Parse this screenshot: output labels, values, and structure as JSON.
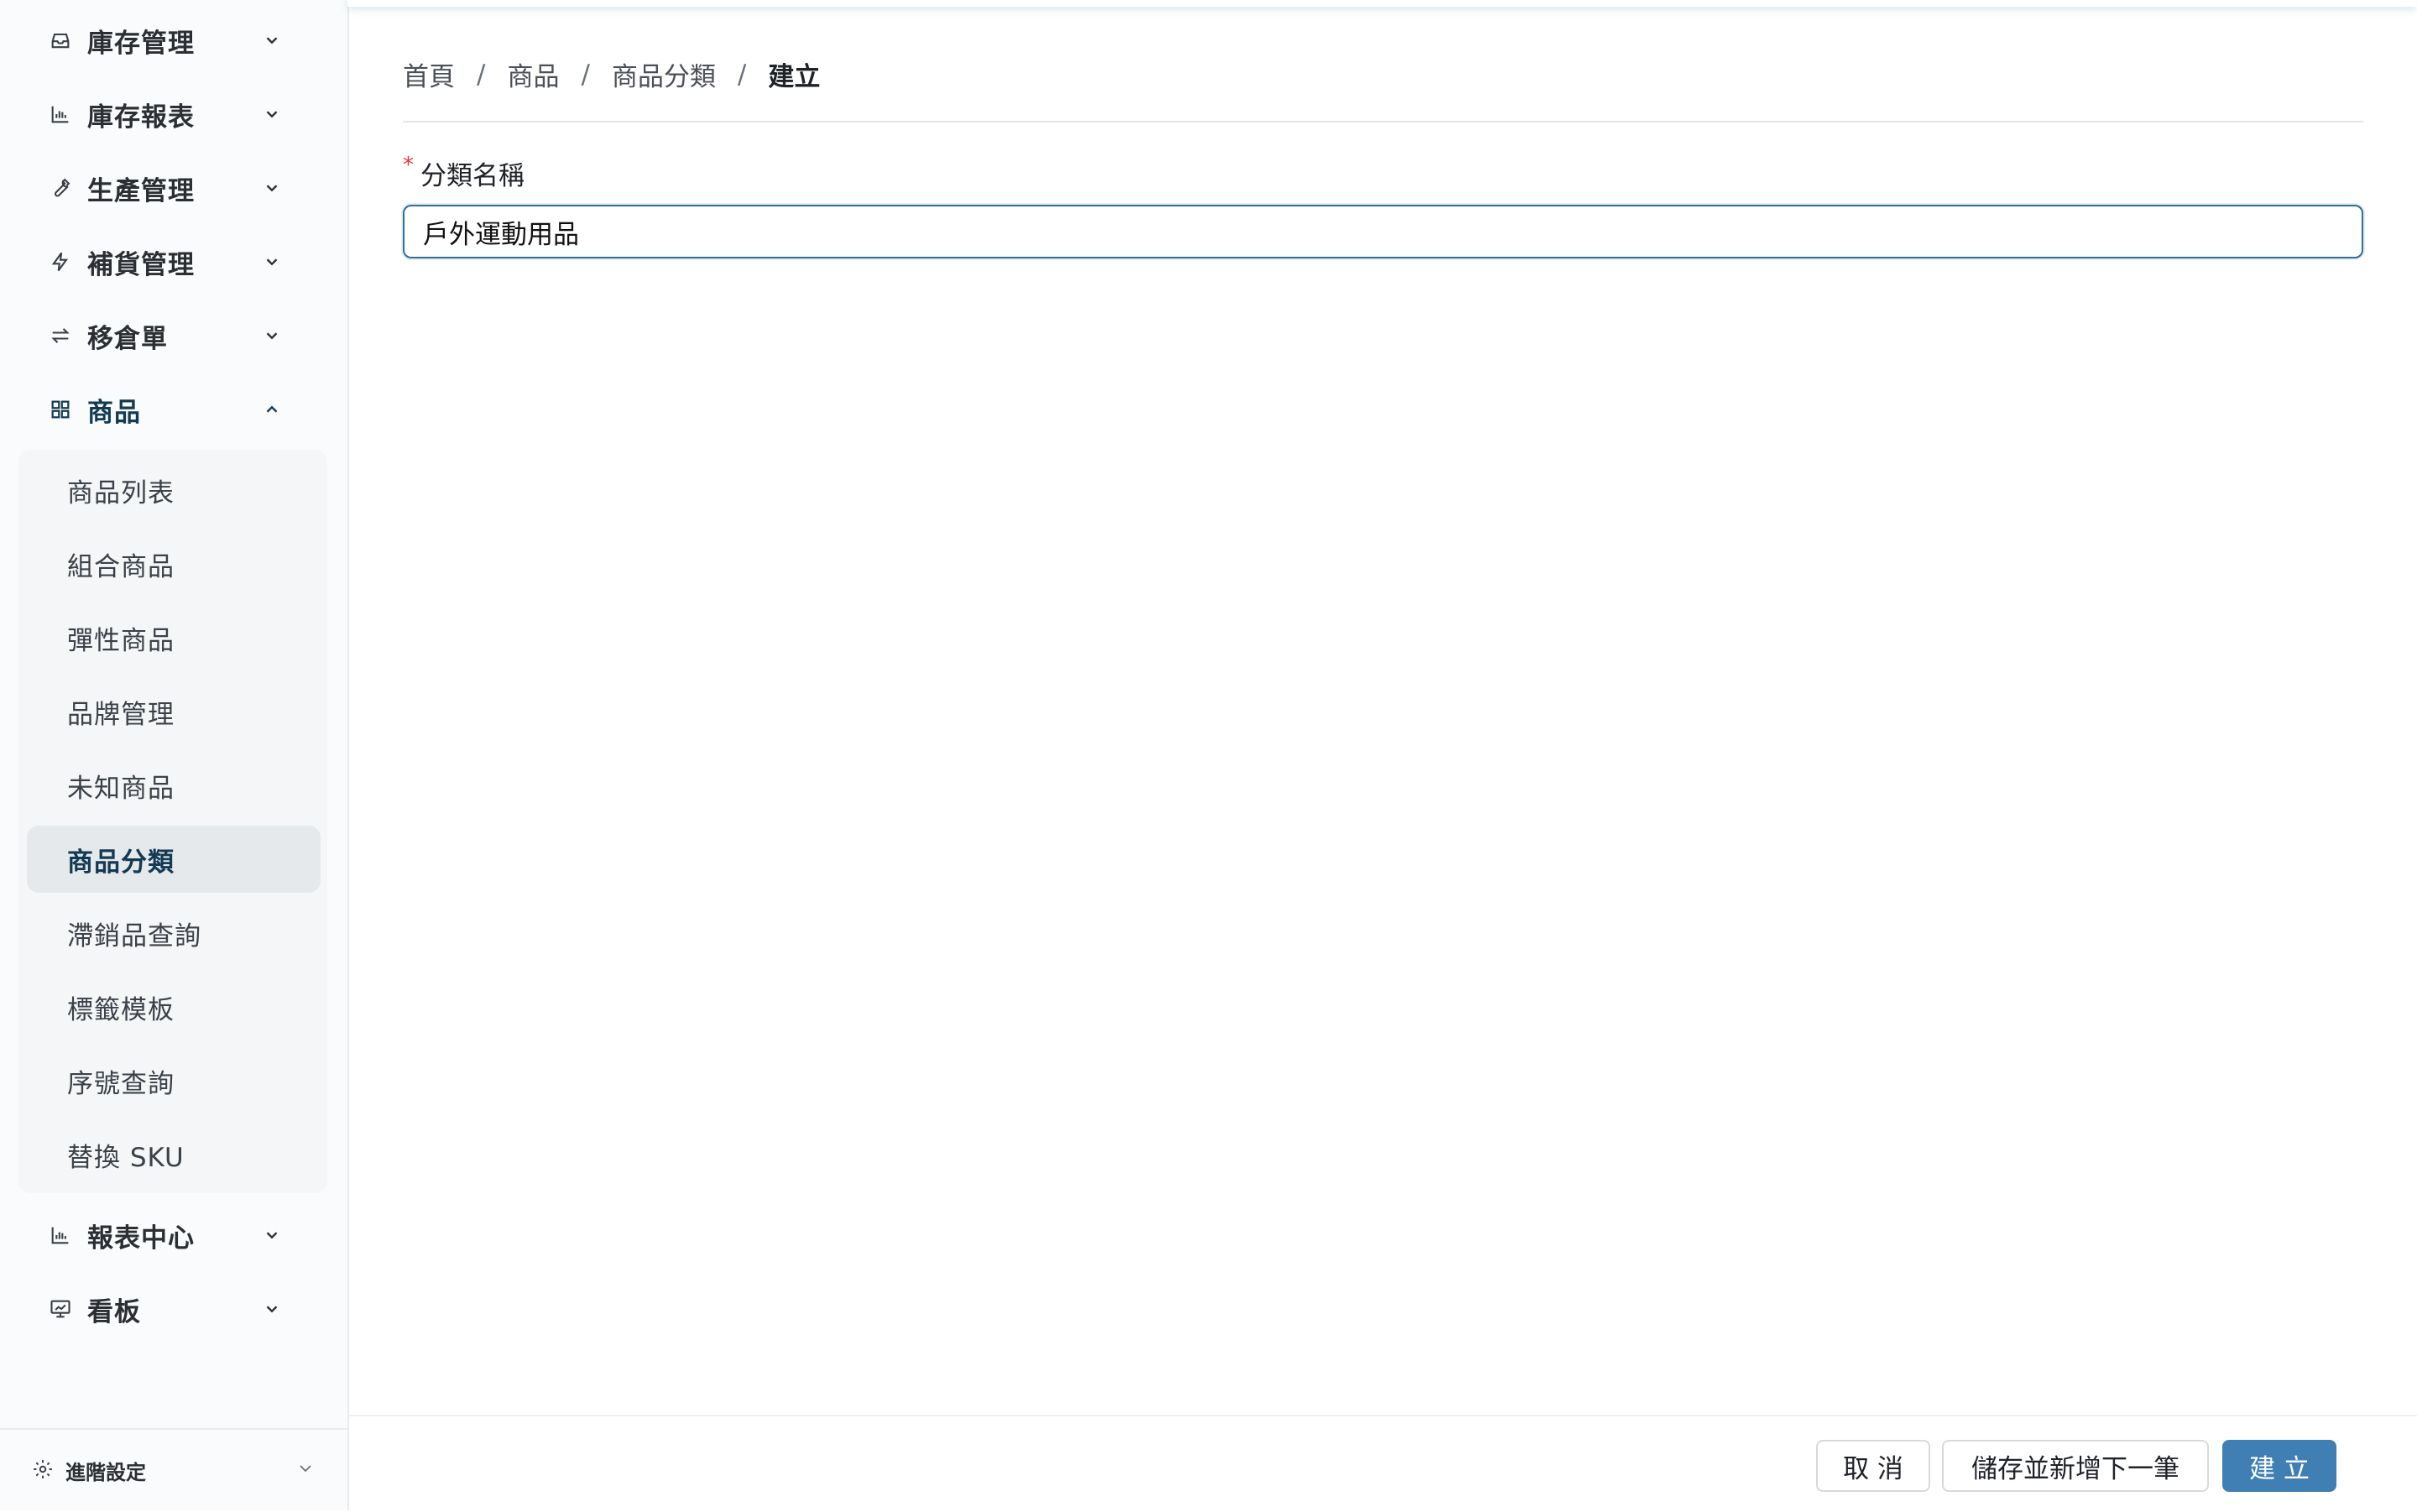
{
  "sidebar": {
    "items": [
      {
        "label": "庫存管理",
        "icon": "inbox-icon"
      },
      {
        "label": "庫存報表",
        "icon": "bar-chart-icon"
      },
      {
        "label": "生產管理",
        "icon": "wrench-icon"
      },
      {
        "label": "補貨管理",
        "icon": "lightning-icon"
      },
      {
        "label": "移倉單",
        "icon": "transfer-icon"
      },
      {
        "label": "商品",
        "icon": "grid-icon",
        "expanded": true
      },
      {
        "label": "報表中心",
        "icon": "bar-chart-icon"
      },
      {
        "label": "看板",
        "icon": "dashboard-icon"
      }
    ],
    "product_subitems": [
      {
        "label": "商品列表"
      },
      {
        "label": "組合商品"
      },
      {
        "label": "彈性商品"
      },
      {
        "label": "品牌管理"
      },
      {
        "label": "未知商品"
      },
      {
        "label": "商品分類",
        "active": true
      },
      {
        "label": "滯銷品查詢"
      },
      {
        "label": "標籤模板"
      },
      {
        "label": "序號查詢"
      },
      {
        "label": "替換 SKU"
      }
    ],
    "footer": {
      "label": "進階設定",
      "icon": "gear-icon"
    }
  },
  "breadcrumb": [
    {
      "label": "首頁"
    },
    {
      "label": "商品"
    },
    {
      "label": "商品分類"
    },
    {
      "label": "建立"
    }
  ],
  "breadcrumb_separator": "/",
  "form": {
    "required_mark": "*",
    "category_name_label": "分類名稱",
    "category_name_value": "戶外運動用品"
  },
  "actions": {
    "cancel_label": "取 消",
    "save_and_new_label": "儲存並新增下一筆",
    "create_label": "建 立"
  },
  "colors": {
    "primary": "#3f7fb3",
    "active_text": "#123a52",
    "required": "#e53935"
  }
}
